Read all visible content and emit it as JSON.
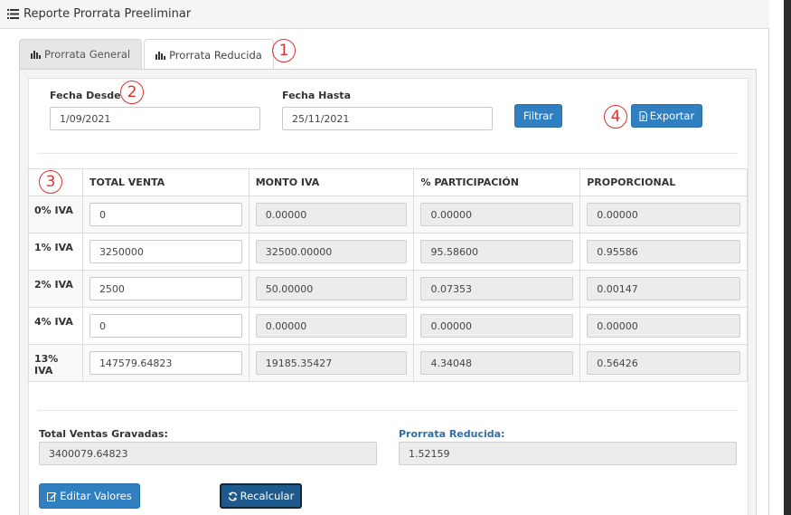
{
  "header": {
    "title": "Reporte Prorrata Preeliminar",
    "icon": "list-icon"
  },
  "tabs": [
    {
      "label": "Prorrata General",
      "icon": "bar-chart-icon",
      "active": false
    },
    {
      "label": "Prorrata Reducida",
      "icon": "bar-chart-icon",
      "active": true
    }
  ],
  "filters": {
    "desde_label": "Fecha Desde",
    "desde_value": "1/09/2021",
    "hasta_label": "Fecha Hasta",
    "hasta_value": "25/11/2021",
    "filtrar_label": "Filtrar",
    "exportar_label": "Exportar"
  },
  "table": {
    "headers": [
      "",
      "TOTAL VENTA",
      "MONTO IVA",
      "% PARTICIPACIÓN",
      "PROPORCIONAL"
    ],
    "rows": [
      {
        "label": "0% IVA",
        "total": "0",
        "monto": "0.00000",
        "participacion": "0.00000",
        "proporcional": "0.00000"
      },
      {
        "label": "1% IVA",
        "total": "3250000",
        "monto": "32500.00000",
        "participacion": "95.58600",
        "proporcional": "0.95586"
      },
      {
        "label": "2% IVA",
        "total": "2500",
        "monto": "50.00000",
        "participacion": "0.07353",
        "proporcional": "0.00147"
      },
      {
        "label": "4% IVA",
        "total": "0",
        "monto": "0.00000",
        "participacion": "0.00000",
        "proporcional": "0.00000"
      },
      {
        "label": "13% IVA",
        "total": "147579.64823",
        "monto": "19185.35427",
        "participacion": "4.34048",
        "proporcional": "0.56426"
      }
    ]
  },
  "summary": {
    "gravadas_label": "Total Ventas Gravadas:",
    "gravadas_value": "3400079.64823",
    "reducida_label": "Prorrata Reducida:",
    "reducida_value": "1.52159"
  },
  "actions": {
    "editar_label": "Editar Valores",
    "recalcular_label": "Recalcular"
  },
  "markers": [
    "1",
    "2",
    "3",
    "4"
  ],
  "colors": {
    "primary": "#2f7fc1",
    "marker": "#e03131",
    "link": "#2f6ea8"
  }
}
